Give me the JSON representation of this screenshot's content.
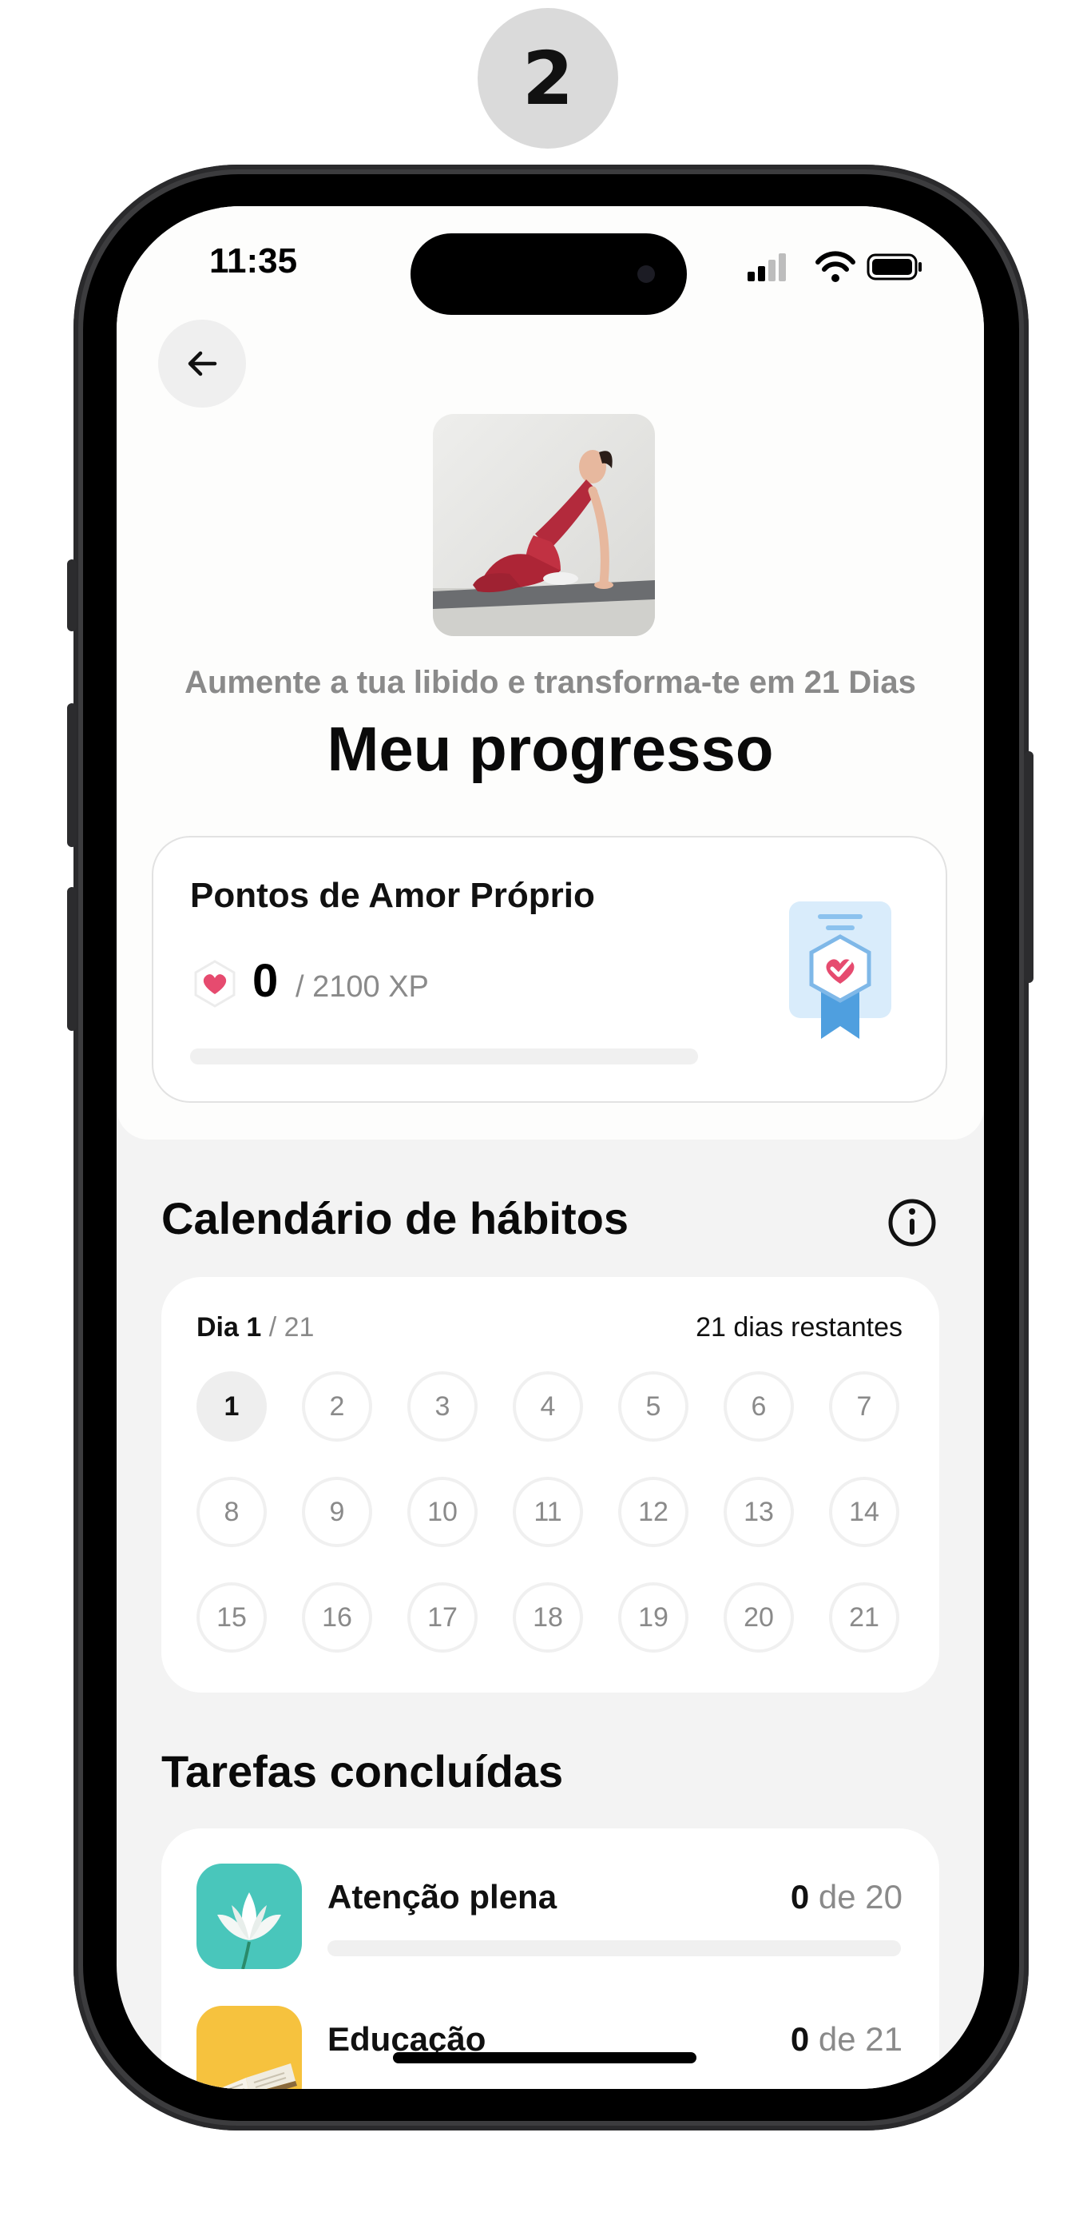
{
  "step_badge": "2",
  "status_bar": {
    "time": "11:35"
  },
  "header": {
    "subtitle": "Aumente a tua libido e transforma-te em 21 Dias",
    "title": "Meu progresso"
  },
  "points": {
    "title": "Pontos de Amor Próprio",
    "value": "0",
    "total": "/ 2100 XP",
    "progress_fraction": 0
  },
  "calendar": {
    "title": "Calendário de hábitos",
    "day_label": "Dia 1",
    "day_total": "/ 21",
    "remaining": "21 dias restantes",
    "current_day": 1,
    "days": [
      "1",
      "2",
      "3",
      "4",
      "5",
      "6",
      "7",
      "8",
      "9",
      "10",
      "11",
      "12",
      "13",
      "14",
      "15",
      "16",
      "17",
      "18",
      "19",
      "20",
      "21"
    ]
  },
  "tasks": {
    "title": "Tarefas concluídas",
    "items": [
      {
        "label": "Atenção plena",
        "done": "0",
        "of": "de 20",
        "progress_fraction": 0,
        "icon": "lotus-icon"
      },
      {
        "label": "Educação",
        "done": "0",
        "of": "de 21",
        "progress_fraction": 0,
        "icon": "book-icon"
      }
    ]
  },
  "colors": {
    "accent_pink": "#e64b6f",
    "teal": "#49c6bb",
    "yellow": "#f6c23e",
    "reward_blue": "#5aa9e6"
  }
}
